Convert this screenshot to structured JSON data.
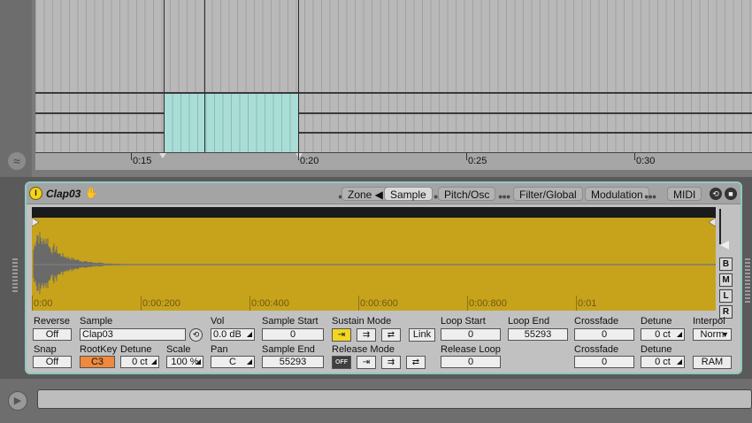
{
  "arrangement": {
    "ruler_labels": [
      "0:15",
      "0:20",
      "0:25",
      "0:30"
    ],
    "icon": "arrangement-fold-icon"
  },
  "clip": {
    "name": "Clap03",
    "activator_icon": "clip-activator-icon",
    "hand_icon": "hand-icon",
    "tabs": {
      "zone": "Zone ◀",
      "sample": "Sample",
      "pitch": "Pitch/Osc",
      "filter": "Filter/Global",
      "modulation": "Modulation",
      "midi": "MIDI"
    }
  },
  "waveform": {
    "time_labels": [
      "0:00",
      "0:00:200",
      "0:00:400",
      "0:00:600",
      "0:00:800",
      "0:01"
    ],
    "color": "#c7a31b",
    "side_buttons": [
      "B",
      "M",
      "L",
      "R"
    ]
  },
  "controls": {
    "reverse": {
      "label": "Reverse",
      "value": "Off"
    },
    "snap": {
      "label": "Snap",
      "value": "Off"
    },
    "sample": {
      "label": "Sample",
      "value": "Clap03"
    },
    "rootkey": {
      "label": "RootKey",
      "value": "C3"
    },
    "detune_small": {
      "label": "Detune",
      "value": "0 ct"
    },
    "scale": {
      "label": "Scale",
      "value": "100 %"
    },
    "vol": {
      "label": "Vol",
      "value": "0.0 dB"
    },
    "pan": {
      "label": "Pan",
      "value": "C"
    },
    "sample_start": {
      "label": "Sample Start",
      "value": "0"
    },
    "sample_end": {
      "label": "Sample End",
      "value": "55293"
    },
    "sustain_mode": {
      "label": "Sustain Mode",
      "link": "Link"
    },
    "release_mode": {
      "label": "Release Mode",
      "off": "OFF"
    },
    "loop_start": {
      "label": "Loop Start",
      "value": "0"
    },
    "loop_end": {
      "label": "Loop End",
      "value": "55293"
    },
    "release_loop": {
      "label": "Release Loop",
      "value": "0"
    },
    "crossfade1": {
      "label": "Crossfade",
      "value": "0"
    },
    "crossfade2": {
      "label": "Crossfade",
      "value": "0"
    },
    "detune1": {
      "label": "Detune",
      "value": "0 ct"
    },
    "detune2": {
      "label": "Detune",
      "value": "0 ct"
    },
    "interpol": {
      "label": "Interpol",
      "value": "Norm"
    },
    "ram": {
      "label": "RAM"
    }
  },
  "colors": {
    "accent": "#8cc9c1",
    "active_yellow": "#f2d622",
    "rootkey_orange": "#ef8a3c"
  }
}
